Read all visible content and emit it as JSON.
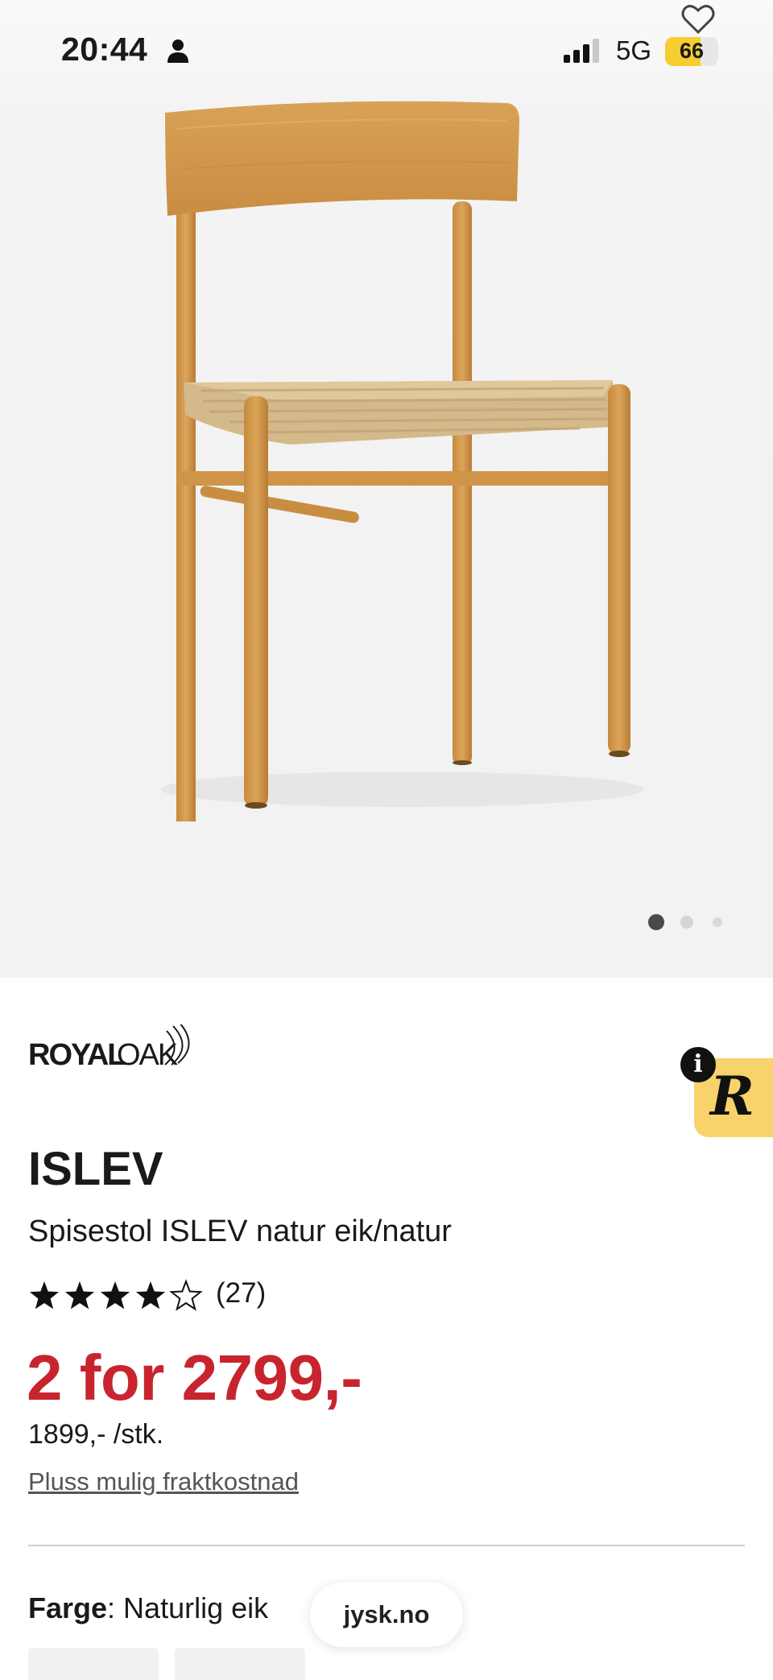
{
  "status_bar": {
    "time": "20:44",
    "network": "5G",
    "battery_level": "66",
    "battery_fraction": 0.66
  },
  "gallery": {
    "image_alt": "Spisestol ISLEV natur eik/natur",
    "image_count": 3,
    "active_index": 0
  },
  "brand": {
    "logo_text": "ROYALOAK"
  },
  "product": {
    "name": "ISLEV",
    "description": "Spisestol ISLEV natur eik/natur",
    "rating_stars": 4,
    "rating_max": 5,
    "review_count": "(27)",
    "price": "2 for 2799,-",
    "unit_price": "1899,- /stk.",
    "shipping_link": "Pluss mulig fraktkostnad"
  },
  "options": {
    "color_label": "Farge",
    "color_value": ": Naturlig eik"
  },
  "browser": {
    "domain": "jysk.no"
  },
  "colors": {
    "price_red": "#c8242e",
    "badge_yellow": "#f8d36b",
    "battery_yellow": "#f7cd2f"
  },
  "icons": [
    "person-icon",
    "signal-icon",
    "wishlist-heart-icon",
    "info-icon",
    "star-icon",
    "star-outline-icon"
  ]
}
